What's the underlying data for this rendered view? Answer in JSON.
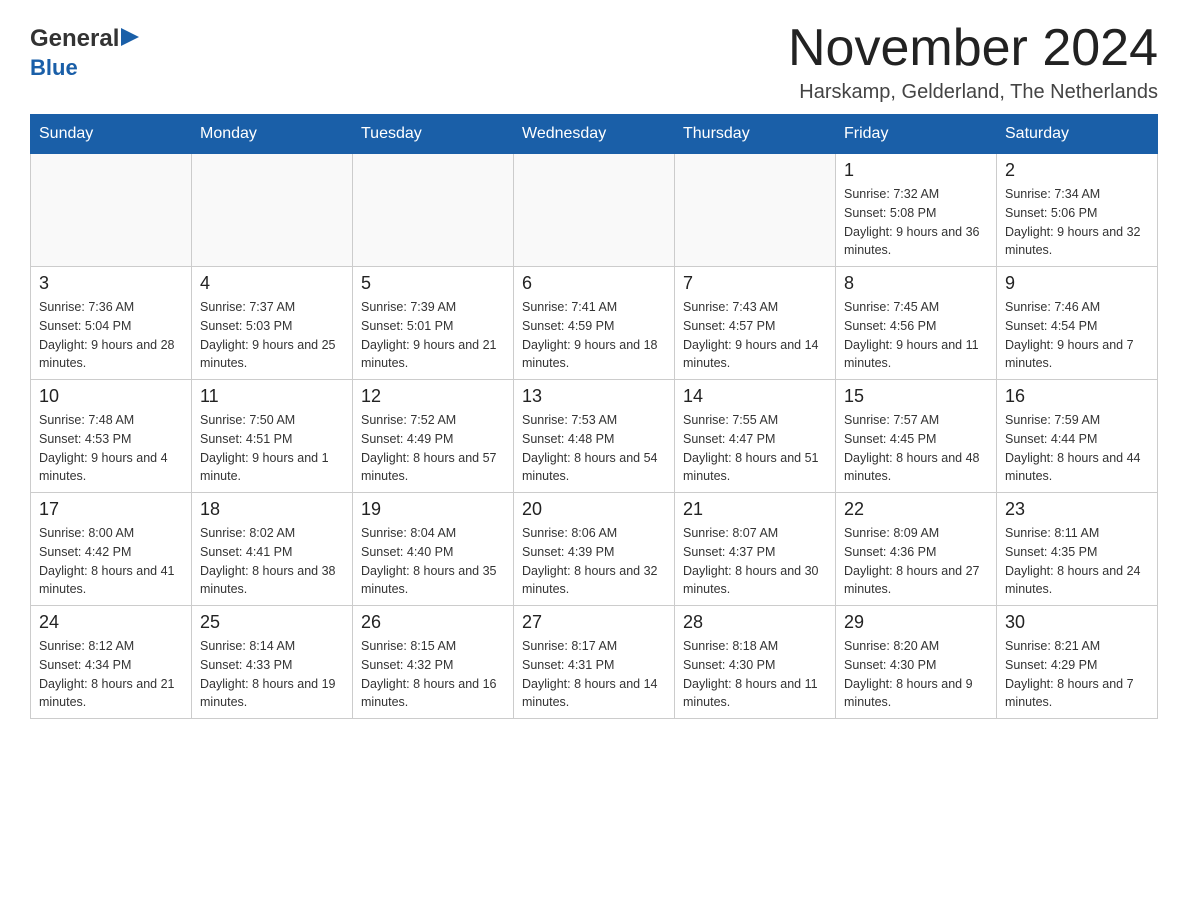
{
  "header": {
    "logo_general": "General",
    "logo_blue": "Blue",
    "month_title": "November 2024",
    "location": "Harskamp, Gelderland, The Netherlands"
  },
  "days_of_week": [
    "Sunday",
    "Monday",
    "Tuesday",
    "Wednesday",
    "Thursday",
    "Friday",
    "Saturday"
  ],
  "weeks": [
    {
      "days": [
        {
          "number": "",
          "info": ""
        },
        {
          "number": "",
          "info": ""
        },
        {
          "number": "",
          "info": ""
        },
        {
          "number": "",
          "info": ""
        },
        {
          "number": "",
          "info": ""
        },
        {
          "number": "1",
          "info": "Sunrise: 7:32 AM\nSunset: 5:08 PM\nDaylight: 9 hours and 36 minutes."
        },
        {
          "number": "2",
          "info": "Sunrise: 7:34 AM\nSunset: 5:06 PM\nDaylight: 9 hours and 32 minutes."
        }
      ]
    },
    {
      "days": [
        {
          "number": "3",
          "info": "Sunrise: 7:36 AM\nSunset: 5:04 PM\nDaylight: 9 hours and 28 minutes."
        },
        {
          "number": "4",
          "info": "Sunrise: 7:37 AM\nSunset: 5:03 PM\nDaylight: 9 hours and 25 minutes."
        },
        {
          "number": "5",
          "info": "Sunrise: 7:39 AM\nSunset: 5:01 PM\nDaylight: 9 hours and 21 minutes."
        },
        {
          "number": "6",
          "info": "Sunrise: 7:41 AM\nSunset: 4:59 PM\nDaylight: 9 hours and 18 minutes."
        },
        {
          "number": "7",
          "info": "Sunrise: 7:43 AM\nSunset: 4:57 PM\nDaylight: 9 hours and 14 minutes."
        },
        {
          "number": "8",
          "info": "Sunrise: 7:45 AM\nSunset: 4:56 PM\nDaylight: 9 hours and 11 minutes."
        },
        {
          "number": "9",
          "info": "Sunrise: 7:46 AM\nSunset: 4:54 PM\nDaylight: 9 hours and 7 minutes."
        }
      ]
    },
    {
      "days": [
        {
          "number": "10",
          "info": "Sunrise: 7:48 AM\nSunset: 4:53 PM\nDaylight: 9 hours and 4 minutes."
        },
        {
          "number": "11",
          "info": "Sunrise: 7:50 AM\nSunset: 4:51 PM\nDaylight: 9 hours and 1 minute."
        },
        {
          "number": "12",
          "info": "Sunrise: 7:52 AM\nSunset: 4:49 PM\nDaylight: 8 hours and 57 minutes."
        },
        {
          "number": "13",
          "info": "Sunrise: 7:53 AM\nSunset: 4:48 PM\nDaylight: 8 hours and 54 minutes."
        },
        {
          "number": "14",
          "info": "Sunrise: 7:55 AM\nSunset: 4:47 PM\nDaylight: 8 hours and 51 minutes."
        },
        {
          "number": "15",
          "info": "Sunrise: 7:57 AM\nSunset: 4:45 PM\nDaylight: 8 hours and 48 minutes."
        },
        {
          "number": "16",
          "info": "Sunrise: 7:59 AM\nSunset: 4:44 PM\nDaylight: 8 hours and 44 minutes."
        }
      ]
    },
    {
      "days": [
        {
          "number": "17",
          "info": "Sunrise: 8:00 AM\nSunset: 4:42 PM\nDaylight: 8 hours and 41 minutes."
        },
        {
          "number": "18",
          "info": "Sunrise: 8:02 AM\nSunset: 4:41 PM\nDaylight: 8 hours and 38 minutes."
        },
        {
          "number": "19",
          "info": "Sunrise: 8:04 AM\nSunset: 4:40 PM\nDaylight: 8 hours and 35 minutes."
        },
        {
          "number": "20",
          "info": "Sunrise: 8:06 AM\nSunset: 4:39 PM\nDaylight: 8 hours and 32 minutes."
        },
        {
          "number": "21",
          "info": "Sunrise: 8:07 AM\nSunset: 4:37 PM\nDaylight: 8 hours and 30 minutes."
        },
        {
          "number": "22",
          "info": "Sunrise: 8:09 AM\nSunset: 4:36 PM\nDaylight: 8 hours and 27 minutes."
        },
        {
          "number": "23",
          "info": "Sunrise: 8:11 AM\nSunset: 4:35 PM\nDaylight: 8 hours and 24 minutes."
        }
      ]
    },
    {
      "days": [
        {
          "number": "24",
          "info": "Sunrise: 8:12 AM\nSunset: 4:34 PM\nDaylight: 8 hours and 21 minutes."
        },
        {
          "number": "25",
          "info": "Sunrise: 8:14 AM\nSunset: 4:33 PM\nDaylight: 8 hours and 19 minutes."
        },
        {
          "number": "26",
          "info": "Sunrise: 8:15 AM\nSunset: 4:32 PM\nDaylight: 8 hours and 16 minutes."
        },
        {
          "number": "27",
          "info": "Sunrise: 8:17 AM\nSunset: 4:31 PM\nDaylight: 8 hours and 14 minutes."
        },
        {
          "number": "28",
          "info": "Sunrise: 8:18 AM\nSunset: 4:30 PM\nDaylight: 8 hours and 11 minutes."
        },
        {
          "number": "29",
          "info": "Sunrise: 8:20 AM\nSunset: 4:30 PM\nDaylight: 8 hours and 9 minutes."
        },
        {
          "number": "30",
          "info": "Sunrise: 8:21 AM\nSunset: 4:29 PM\nDaylight: 8 hours and 7 minutes."
        }
      ]
    }
  ]
}
